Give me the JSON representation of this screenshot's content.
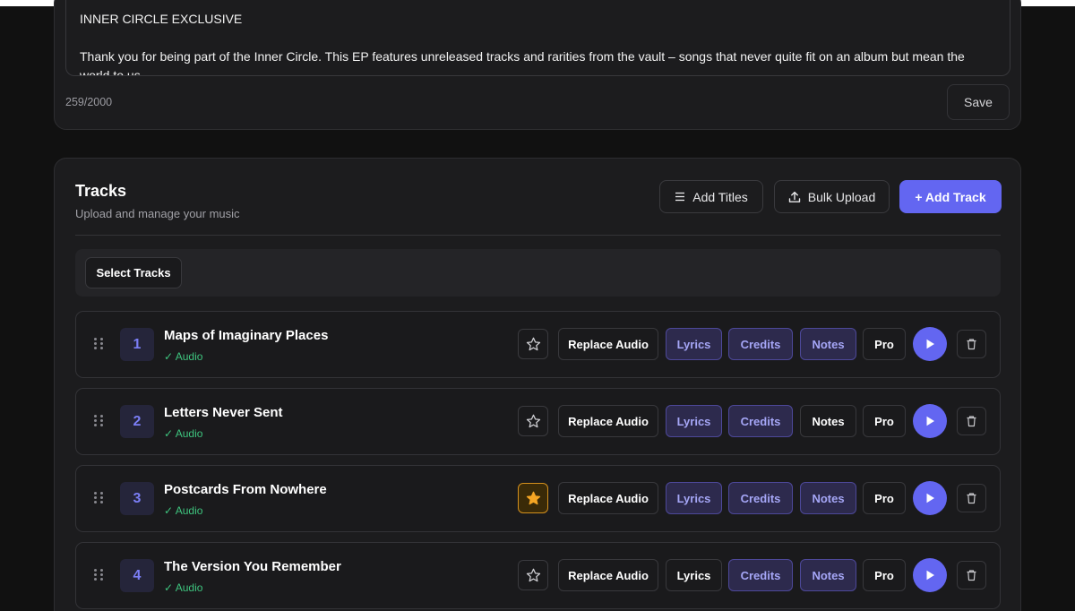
{
  "description": {
    "text": "INNER CIRCLE EXCLUSIVE\n\nThank you for being part of the Inner Circle. This EP features unreleased tracks and rarities from the vault – songs that never quite fit on an album but mean the world to us.",
    "char_count": "259/2000",
    "save_label": "Save"
  },
  "tracks": {
    "title": "Tracks",
    "subtitle": "Upload and manage your music",
    "add_titles_label": "Add Titles",
    "bulk_upload_label": "Bulk Upload",
    "add_track_label": "+ Add Track",
    "select_tracks_label": "Select Tracks",
    "button_labels": {
      "replace_audio": "Replace Audio",
      "lyrics": "Lyrics",
      "credits": "Credits",
      "notes": "Notes",
      "pro": "Pro"
    },
    "items": [
      {
        "number": "1",
        "title": "Maps of Imaginary Places",
        "status": "✓ Audio",
        "favorite": false,
        "lyrics_active": true,
        "credits_active": true,
        "notes_active": true
      },
      {
        "number": "2",
        "title": "Letters Never Sent",
        "status": "✓ Audio",
        "favorite": false,
        "lyrics_active": true,
        "credits_active": true,
        "notes_active": false
      },
      {
        "number": "3",
        "title": "Postcards From Nowhere",
        "status": "✓ Audio",
        "favorite": true,
        "lyrics_active": true,
        "credits_active": true,
        "notes_active": true
      },
      {
        "number": "4",
        "title": "The Version You Remember",
        "status": "✓ Audio",
        "favorite": false,
        "lyrics_active": false,
        "credits_active": true,
        "notes_active": true
      }
    ]
  },
  "colors": {
    "accent": "#6366f1",
    "success": "#3ec47e",
    "favorite": "#f5a524"
  },
  "icons": {
    "add_titles": "list-icon",
    "bulk_upload": "upload-icon",
    "drag": "drag-handle-icon",
    "star": "star-icon",
    "play": "play-icon",
    "delete": "trash-icon"
  }
}
